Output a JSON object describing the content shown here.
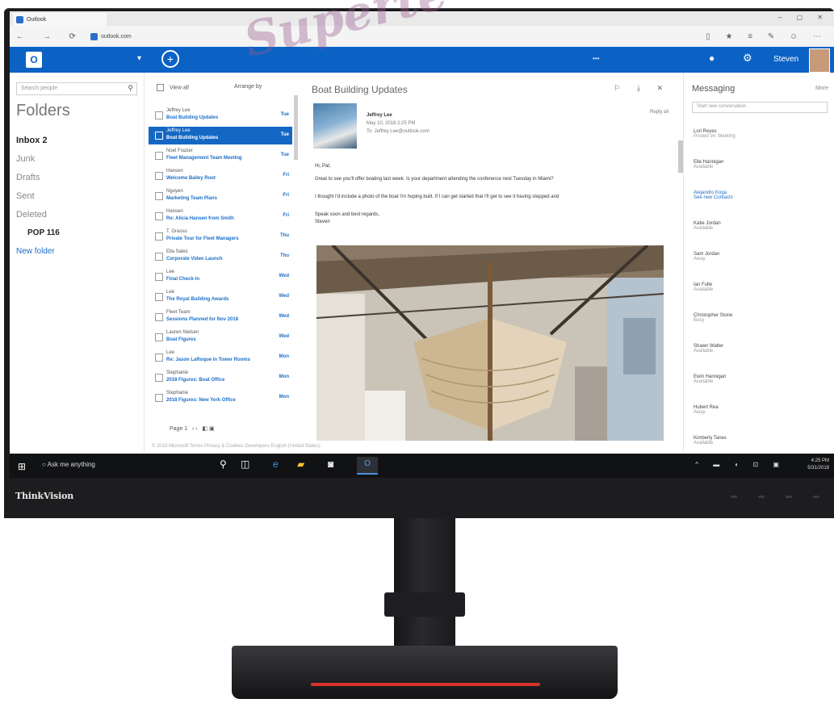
{
  "watermark": "Superte",
  "monitor": {
    "brand": "ThinkVision"
  },
  "browser": {
    "tab_title": "Outlook",
    "url": "outlook.com"
  },
  "suite": {
    "user_name": "Steven"
  },
  "folders": {
    "search_placeholder": "Search people",
    "title": "Folders",
    "items": [
      {
        "label": "Inbox  2"
      },
      {
        "label": "Junk"
      },
      {
        "label": "Drafts"
      },
      {
        "label": "Sent"
      },
      {
        "label": "Deleted"
      },
      {
        "label": "POP 116"
      },
      {
        "label": "New folder"
      }
    ]
  },
  "list": {
    "view_all": "View all",
    "arrange_by": "Arrange by",
    "messages": [
      {
        "from": "Jeffrey Lee",
        "subject": "Boat Building Updates",
        "date": "Tue"
      },
      {
        "from": "Jeffrey Lee",
        "subject": "Boat Building Updates",
        "date": "Tue"
      },
      {
        "from": "Noel Frazier",
        "subject": "Fleet Management Team Meeting",
        "date": "Tue"
      },
      {
        "from": "Hansen",
        "subject": "Welcome Bailey Root",
        "date": "Fri"
      },
      {
        "from": "Nguyen",
        "subject": "Marketing Team Plans",
        "date": "Fri"
      },
      {
        "from": "Hansen",
        "subject": "Re: Alicia Hansen from Smith",
        "date": "Fri"
      },
      {
        "from": "T. Grasso",
        "subject": "Private Tour for Fleet Managers",
        "date": "Thu"
      },
      {
        "from": "Ella Sales",
        "subject": "Corporate Video Launch",
        "date": "Thu"
      },
      {
        "from": "Lee",
        "subject": "Final Check-in",
        "date": "Wed"
      },
      {
        "from": "Lee",
        "subject": "The Royal Building Awards",
        "date": "Wed"
      },
      {
        "from": "Fleet Team",
        "subject": "Sessions Planned for Nov 2018",
        "date": "Wed"
      },
      {
        "from": "Lauren Nielsen",
        "subject": "Boat Figures",
        "date": "Wed"
      },
      {
        "from": "Lee",
        "subject": "Re: Jason LaRoque in Tower Rooms",
        "date": "Mon"
      },
      {
        "from": "Stephanie",
        "subject": "2018 Figures: Boat Office",
        "date": "Mon"
      },
      {
        "from": "Stephanie",
        "subject": "2018 Figures: New York Office",
        "date": "Mon"
      }
    ],
    "pager": "Page 1"
  },
  "reader": {
    "title": "Boat Building Updates",
    "from": "Jeffrey Lee",
    "date": "May 10, 2018   2:25 PM",
    "to": "To: Jeffrey Lee@outlook.com",
    "reply_all": "Reply all",
    "greeting": "Hi, Pat,",
    "para1": "Great to see you'll offer boating last week. Is your department attending the conference next Tuesday in Miami?",
    "para2": "I thought I'd include a photo of the boat I'm hoping built. If I can get started that I'll get to see it having stepped and",
    "para3": "Speak soon and best regards,",
    "signoff": "Steven"
  },
  "messaging": {
    "title": "Messaging",
    "more": "More",
    "search_placeholder": "Start new conversation",
    "contacts": [
      {
        "name": "Lori Reyes",
        "preview": "Posted on: Meeting"
      },
      {
        "name": "Elle Hannigan",
        "preview": "Available"
      },
      {
        "name": "Alejandro Koga",
        "preview": "See new Contacts"
      },
      {
        "name": "Katie Jordan",
        "preview": "Available"
      },
      {
        "name": "Sam Jordan",
        "preview": "Away"
      },
      {
        "name": "Ian Fulle",
        "preview": "Available"
      },
      {
        "name": "Christopher Stone",
        "preview": "Busy"
      },
      {
        "name": "Shawn Walter",
        "preview": "Available"
      },
      {
        "name": "Ewin Hannigan",
        "preview": "Available"
      },
      {
        "name": "Hubert Rea",
        "preview": "Away"
      },
      {
        "name": "Kimberly Tanes",
        "preview": "Available"
      }
    ]
  },
  "footer": "© 2018 Microsoft   Terms   Privacy & Cookies   Developers   English (United States)",
  "taskbar": {
    "search_text": "Ask me anything",
    "time": "4:25 PM",
    "date": "5/31/2018"
  }
}
